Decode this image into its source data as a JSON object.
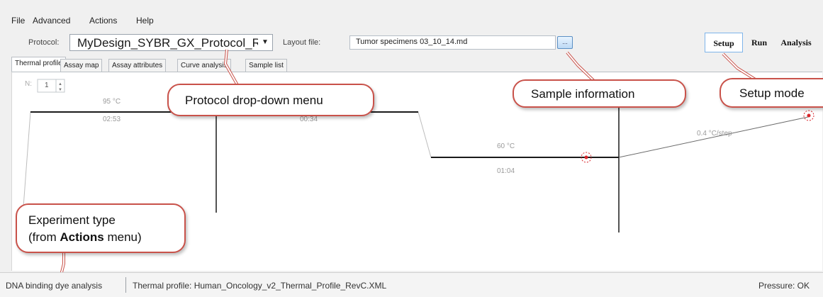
{
  "menu": [
    "File",
    "Advanced",
    "Actions",
    "Help"
  ],
  "toolbar": {
    "protocol_label": "Protocol:",
    "protocol_value": "MyDesign_SYBR_GX_Protocol_Re",
    "layout_label": "Layout file:",
    "layout_value": "Tumor specimens 03_10_14.md",
    "browse_label": "..."
  },
  "modes": {
    "setup": "Setup",
    "run": "Run",
    "analysis": "Analysis",
    "active": "Setup"
  },
  "tabs": [
    "Thermal profile",
    "Assay map",
    "Assay attributes",
    "Curve analysis",
    "Sample list"
  ],
  "profile": {
    "n_label": "N:",
    "n_value": "1",
    "steps": [
      {
        "temp": "95 °C",
        "time": "02:53"
      },
      {
        "temp": "",
        "time": "00:34"
      },
      {
        "temp": "60 °C",
        "time": "01:04"
      }
    ],
    "ramp_label": "0.4 °C/step"
  },
  "callouts": {
    "protocol": "Protocol drop-down menu",
    "sample": "Sample information",
    "setup": "Setup mode",
    "experiment_line1": "Experiment type",
    "experiment_line2_pre": "(from ",
    "experiment_line2_bold": "Actions",
    "experiment_line2_post": " menu)"
  },
  "status": {
    "experiment_type": "DNA binding dye analysis",
    "thermal_profile": "Thermal profile: Human_Oncology_v2_Thermal_Profile_RevC.XML",
    "pressure": "Pressure: OK"
  },
  "colors": {
    "callout_border": "#c9524a",
    "setup_border": "#7eb4ea",
    "graph_line": "#1a1a1a",
    "marker": "#d9252a"
  },
  "icons": [
    "spinner-icon",
    "marker-icon",
    "browse-icon",
    "dropdown-arrow-icon"
  ]
}
